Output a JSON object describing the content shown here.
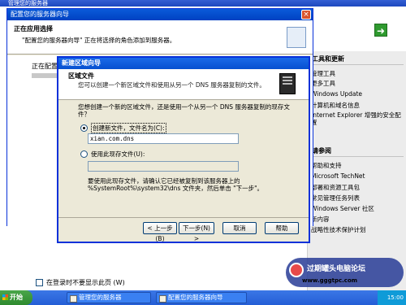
{
  "desktop": {
    "title": "管理您的服务器"
  },
  "manager": {
    "side_sections": [
      {
        "title": "工具和更新",
        "links": [
          "管理工具",
          "更多工具",
          "Windows Update",
          "计算机和域名信息",
          "Internet Explorer 增强的安全配置"
        ]
      },
      {
        "title": "请参阅",
        "links": [
          "帮助和支持",
          "Microsoft TechNet",
          "部署和资源工具包",
          "常见管理任务列表",
          "Windows Server 社区",
          "新内容",
          "战略性技术保护计划"
        ]
      }
    ],
    "dont_show_label": "在登录时不要显示此页 (W)"
  },
  "wizard1": {
    "title": "配置您的服务器向导",
    "heading": "正在应用选择",
    "subheading": "\"配置您的服务器向导\" 正在将选择的角色添加到服务器。",
    "applying": "正在配置 ..."
  },
  "wizard2": {
    "title": "新建区域向导",
    "heading": "区域文件",
    "subheading": "您可以创建一个新区域文件和使用从另一个 DNS 服务器复制的文件。",
    "question": "您想创建一个新的区域文件，还是使用一个从另一个 DNS 服务器复制的现存文件？",
    "option_new_label": "创建新文件，文件名为(C):",
    "option_new_value": "xian.com.dns",
    "option_existing_label": "使用此现存文件(U):",
    "option_existing_value": "",
    "browse_label": "",
    "note": "要使用此现存文件，请确认它已经被复制到该服务器上的 %SystemRoot%\\system32\\dns 文件夹，然后单击 \"下一步\"。",
    "buttons": {
      "back": "< 上一步(B)",
      "next": "下一步(N) >",
      "cancel": "取消",
      "help": "帮助"
    }
  },
  "watermark": {
    "text": "过期罐头电脑论坛",
    "url": "www.gggtpc.com"
  },
  "taskbar": {
    "start": "开始",
    "items": [
      "管理您的服务器",
      "配置您的服务器向导"
    ],
    "clock": "15:00"
  }
}
